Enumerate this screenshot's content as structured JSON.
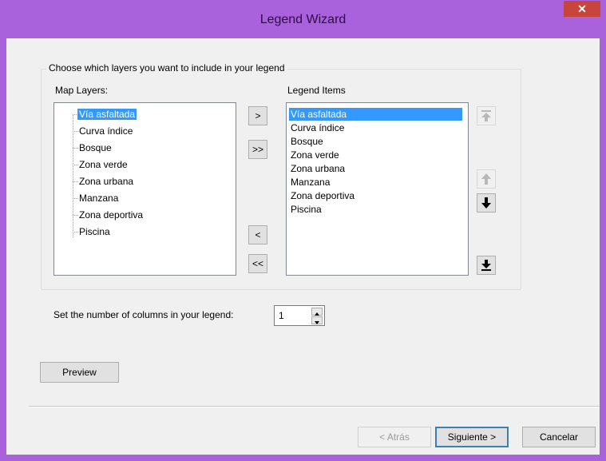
{
  "window": {
    "title": "Legend Wizard",
    "close_glyph": "✕"
  },
  "group": {
    "title": "Choose which layers you want to include in your legend",
    "map_layers_label": "Map Layers:",
    "legend_items_label": "Legend Items",
    "map_layers": [
      "Vía asfaltada",
      "Curva índice",
      "Bosque",
      "Zona verde",
      "Zona urbana",
      "Manzana",
      "Zona deportiva",
      "Piscina"
    ],
    "legend_items": [
      "Vía asfaltada",
      "Curva índice",
      "Bosque",
      "Zona verde",
      "Zona urbana",
      "Manzana",
      "Zona deportiva",
      "Piscina"
    ],
    "move_buttons": {
      "add": ">",
      "add_all": ">>",
      "remove": "<",
      "remove_all": "<<"
    }
  },
  "columns": {
    "label": "Set the number of columns in your legend:",
    "value": "1"
  },
  "preview_label": "Preview",
  "footer": {
    "back": "< Atrás",
    "next": "Siguiente >",
    "cancel": "Cancelar"
  },
  "icons": {
    "move_top": "move-to-top-icon",
    "move_up": "move-up-icon",
    "move_down": "move-down-icon",
    "move_bottom": "move-to-bottom-icon"
  }
}
